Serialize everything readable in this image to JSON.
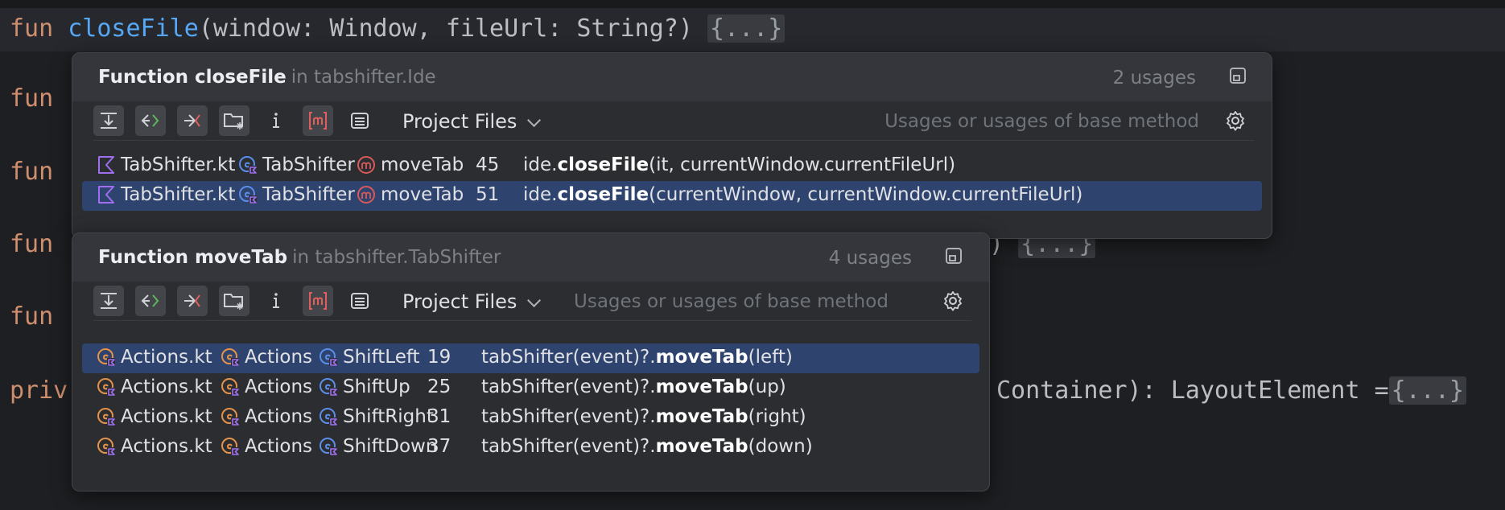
{
  "editor": {
    "lines": [
      {
        "keyword": "fun",
        "name": "closeFile",
        "rest": "(window: Window, fileUrl: String?) ",
        "fold": "{...}"
      },
      {
        "keyword": "fun",
        "tail": "",
        "fold": ""
      },
      {
        "keyword": "fun",
        "tail": "",
        "fold": ""
      },
      {
        "keyword": "fun",
        "tail": ") ",
        "fold": "{...}"
      },
      {
        "keyword": "fun",
        "tail": "",
        "fold": ""
      },
      {
        "keyword": "priv",
        "tail": "Container): LayoutElement =",
        "fold": "{...}"
      }
    ]
  },
  "popup1": {
    "kind": "Function",
    "name": "closeFile",
    "location": "in tabshifter.Ide",
    "count": "2 usages",
    "scope": "Project Files",
    "filter_hint": "Usages or usages of base method",
    "rows": [
      {
        "file": "TabShifter.kt",
        "cls": "TabShifter",
        "method": "moveTab",
        "line": "45",
        "pre": "ide.",
        "bold": "closeFile",
        "post": "(it, currentWindow.currentFileUrl)",
        "selected": false
      },
      {
        "file": "TabShifter.kt",
        "cls": "TabShifter",
        "method": "moveTab",
        "line": "51",
        "pre": "ide.",
        "bold": "closeFile",
        "post": "(currentWindow, currentWindow.currentFileUrl)",
        "selected": true
      }
    ]
  },
  "popup2": {
    "kind": "Function",
    "name": "moveTab",
    "location": "in tabshifter.TabShifter",
    "count": "4 usages",
    "scope": "Project Files",
    "filter_hint": "Usages or usages of base method",
    "rows": [
      {
        "file": "Actions.kt",
        "cls": "Actions",
        "method": "ShiftLeft",
        "line": "19",
        "pre": "tabShifter(event)?.",
        "bold": "moveTab",
        "post": "(left)",
        "selected": true
      },
      {
        "file": "Actions.kt",
        "cls": "Actions",
        "method": "ShiftUp",
        "line": "25",
        "pre": "tabShifter(event)?.",
        "bold": "moveTab",
        "post": "(up)",
        "selected": false
      },
      {
        "file": "Actions.kt",
        "cls": "Actions",
        "method": "ShiftRight",
        "line": "31",
        "pre": "tabShifter(event)?.",
        "bold": "moveTab",
        "post": "(right)",
        "selected": false
      },
      {
        "file": "Actions.kt",
        "cls": "Actions",
        "method": "ShiftDown",
        "line": "37",
        "pre": "tabShifter(event)?.",
        "bold": "moveTab",
        "post": "(down)",
        "selected": false
      }
    ]
  },
  "icons": {
    "kotlin_file": "kotlin-file-icon",
    "kotlin_class": "kotlin-class-icon",
    "method": "method-icon",
    "class_file": "class-file-icon",
    "object_class": "object-class-icon",
    "pin": "pin-icon",
    "settings": "gear-icon",
    "toolbar": [
      "merge-usages-icon",
      "show-read-access-icon",
      "show-write-access-icon",
      "group-by-directory-icon",
      "info-icon",
      "group-by-method-icon",
      "preview-icon"
    ]
  },
  "colors": {
    "selection": "#2e436e",
    "keyword": "#cf8e6d",
    "function": "#56a8f5",
    "kotlin_purple": "#9f6fef",
    "method_red": "#d95a5a",
    "class_orange": "#e5924b",
    "class_blue": "#5b8ee8"
  }
}
